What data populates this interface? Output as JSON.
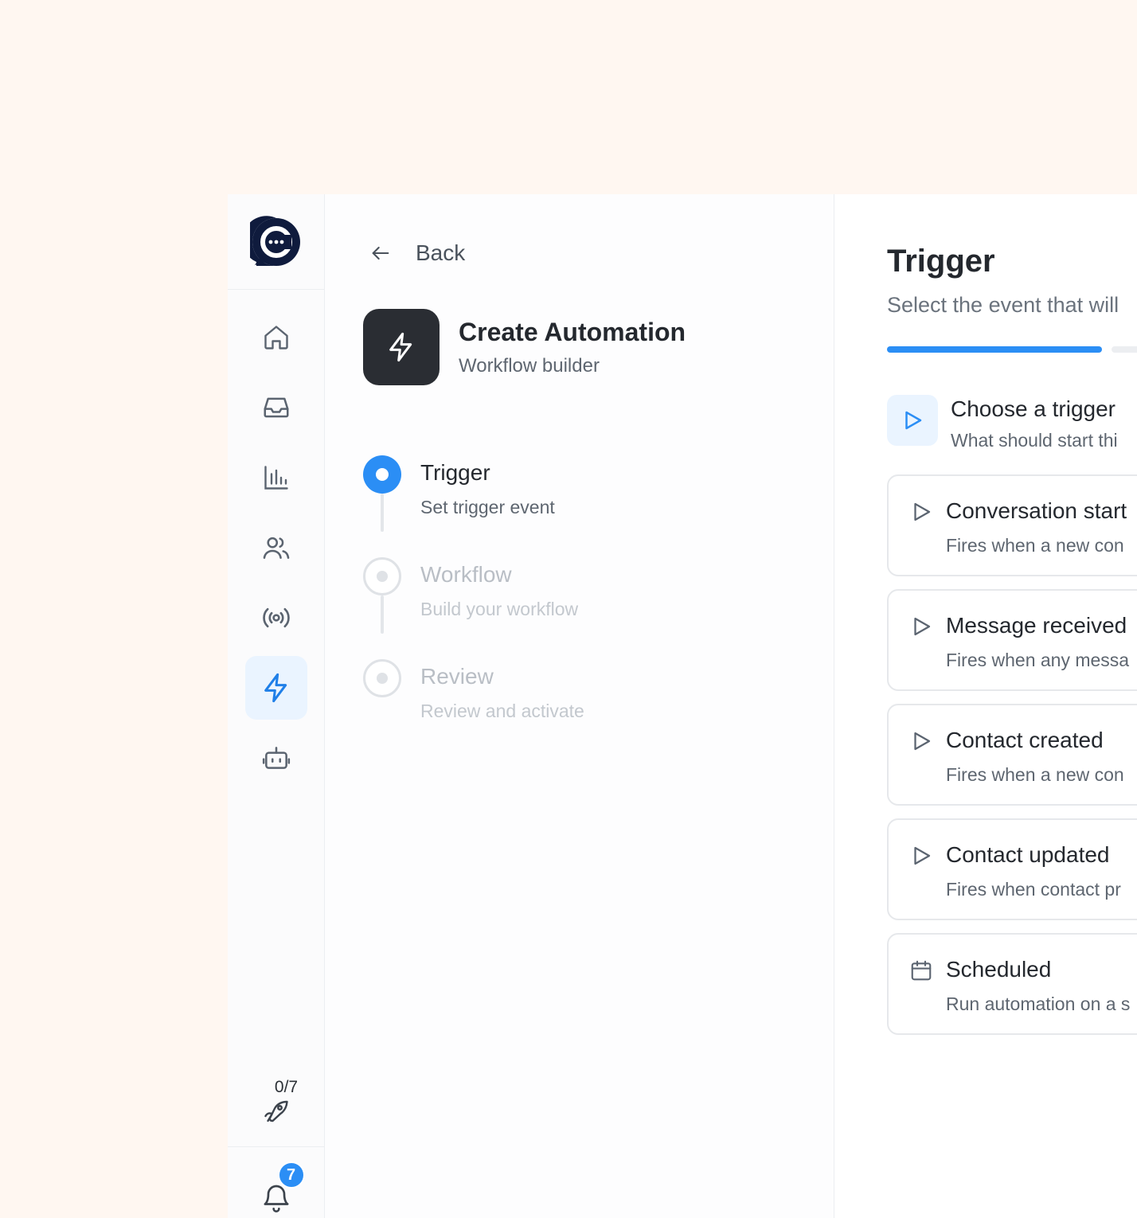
{
  "sidebar": {
    "items": [
      {
        "name": "home-icon",
        "active": false
      },
      {
        "name": "inbox-icon",
        "active": false
      },
      {
        "name": "reports-icon",
        "active": false
      },
      {
        "name": "contacts-icon",
        "active": false
      },
      {
        "name": "broadcast-icon",
        "active": false
      },
      {
        "name": "automation-icon",
        "active": true
      },
      {
        "name": "bot-icon",
        "active": false
      }
    ],
    "onboarding_progress": "0/7",
    "notifications_count": "7"
  },
  "middle": {
    "back_label": "Back",
    "title": "Create Automation",
    "subtitle": "Workflow builder",
    "steps": [
      {
        "title": "Trigger",
        "subtitle": "Set trigger event",
        "state": "active"
      },
      {
        "title": "Workflow",
        "subtitle": "Build your workflow",
        "state": "idle"
      },
      {
        "title": "Review",
        "subtitle": "Review and activate",
        "state": "idle"
      }
    ]
  },
  "right": {
    "title": "Trigger",
    "subtitle": "Select the event that will",
    "choose": {
      "title": "Choose a trigger",
      "subtitle": "What should start thi"
    },
    "triggers": [
      {
        "title": "Conversation start",
        "subtitle": "Fires when a new con",
        "icon": "play-icon"
      },
      {
        "title": "Message received",
        "subtitle": "Fires when any messa",
        "icon": "play-icon"
      },
      {
        "title": "Contact created",
        "subtitle": "Fires when a new con",
        "icon": "play-icon"
      },
      {
        "title": "Contact updated",
        "subtitle": "Fires when contact pr",
        "icon": "play-icon"
      },
      {
        "title": "Scheduled",
        "subtitle": "Run automation on a s",
        "icon": "calendar-icon"
      }
    ]
  },
  "colors": {
    "accent": "#2b8ef5",
    "page_bg": "#fff7f1",
    "dark_tile": "#2a2d33"
  }
}
